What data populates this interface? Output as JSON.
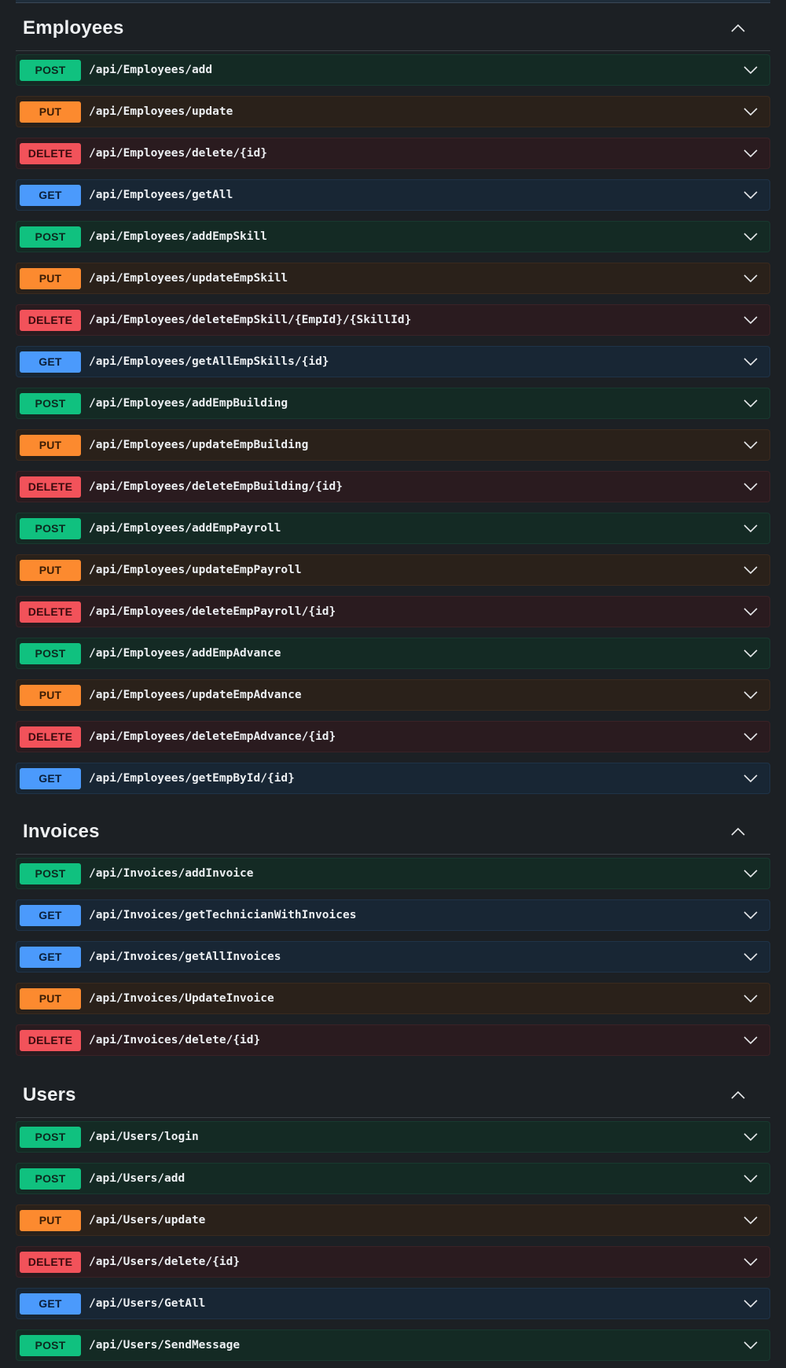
{
  "sections": [
    {
      "title": "Employees",
      "collapse_icon": "chevron-up-icon",
      "operations": [
        {
          "method": "POST",
          "path": "/api/Employees/add"
        },
        {
          "method": "PUT",
          "path": "/api/Employees/update"
        },
        {
          "method": "DELETE",
          "path": "/api/Employees/delete/{id}"
        },
        {
          "method": "GET",
          "path": "/api/Employees/getAll"
        },
        {
          "method": "POST",
          "path": "/api/Employees/addEmpSkill"
        },
        {
          "method": "PUT",
          "path": "/api/Employees/updateEmpSkill"
        },
        {
          "method": "DELETE",
          "path": "/api/Employees/deleteEmpSkill/{EmpId}/{SkillId}"
        },
        {
          "method": "GET",
          "path": "/api/Employees/getAllEmpSkills/{id}"
        },
        {
          "method": "POST",
          "path": "/api/Employees/addEmpBuilding"
        },
        {
          "method": "PUT",
          "path": "/api/Employees/updateEmpBuilding"
        },
        {
          "method": "DELETE",
          "path": "/api/Employees/deleteEmpBuilding/{id}"
        },
        {
          "method": "POST",
          "path": "/api/Employees/addEmpPayroll"
        },
        {
          "method": "PUT",
          "path": "/api/Employees/updateEmpPayroll"
        },
        {
          "method": "DELETE",
          "path": "/api/Employees/deleteEmpPayroll/{id}"
        },
        {
          "method": "POST",
          "path": "/api/Employees/addEmpAdvance"
        },
        {
          "method": "PUT",
          "path": "/api/Employees/updateEmpAdvance"
        },
        {
          "method": "DELETE",
          "path": "/api/Employees/deleteEmpAdvance/{id}"
        },
        {
          "method": "GET",
          "path": "/api/Employees/getEmpById/{id}"
        }
      ]
    },
    {
      "title": "Invoices",
      "collapse_icon": "chevron-up-icon",
      "operations": [
        {
          "method": "POST",
          "path": "/api/Invoices/addInvoice"
        },
        {
          "method": "GET",
          "path": "/api/Invoices/getTechnicianWithInvoices"
        },
        {
          "method": "GET",
          "path": "/api/Invoices/getAllInvoices"
        },
        {
          "method": "PUT",
          "path": "/api/Invoices/UpdateInvoice"
        },
        {
          "method": "DELETE",
          "path": "/api/Invoices/delete/{id}"
        }
      ]
    },
    {
      "title": "Users",
      "collapse_icon": "chevron-up-icon",
      "operations": [
        {
          "method": "POST",
          "path": "/api/Users/login"
        },
        {
          "method": "POST",
          "path": "/api/Users/add"
        },
        {
          "method": "PUT",
          "path": "/api/Users/update"
        },
        {
          "method": "DELETE",
          "path": "/api/Users/delete/{id}"
        },
        {
          "method": "GET",
          "path": "/api/Users/GetAll"
        },
        {
          "method": "POST",
          "path": "/api/Users/SendMessage"
        }
      ]
    }
  ],
  "operation_expand_icon": "chevron-down-icon",
  "colors": {
    "background": "#1c2024",
    "post": "#10c17f",
    "put": "#fc8a2f",
    "delete": "#f2525a",
    "get": "#4b9afc"
  }
}
